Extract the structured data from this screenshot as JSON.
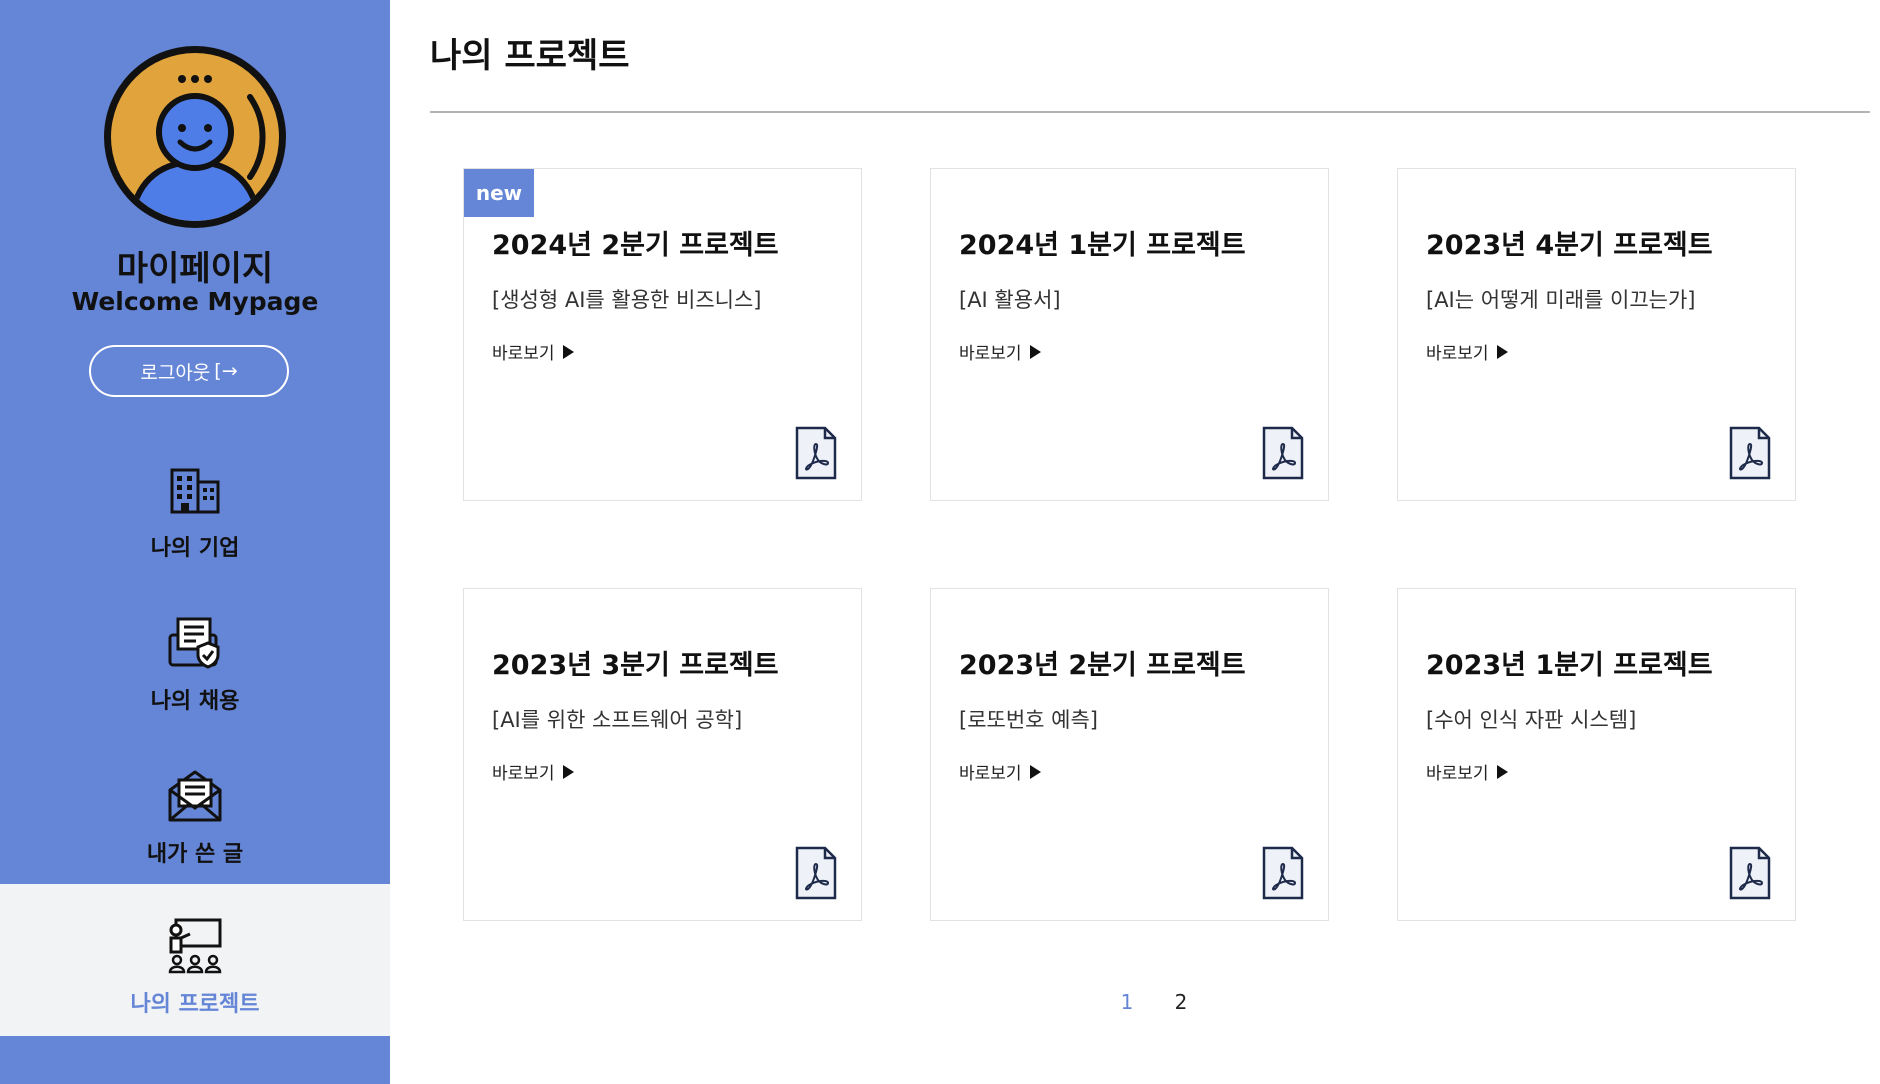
{
  "sidebar": {
    "title": "마이페이지",
    "subtitle": "Welcome Mypage",
    "logout_label": "로그아웃",
    "logout_arrow": "[→",
    "nav": [
      {
        "label": "나의 기업",
        "icon": "building-icon"
      },
      {
        "label": "나의 채용",
        "icon": "document-shield-icon"
      },
      {
        "label": "내가 쓴 글",
        "icon": "mail-icon"
      },
      {
        "label": "나의 프로젝트",
        "icon": "presentation-icon",
        "active": true
      }
    ],
    "colors": {
      "background": "#6585d6",
      "active_bg": "#f2f3f5",
      "avatar_ring": "#e1a43c",
      "avatar_person": "#4f7de8"
    }
  },
  "main": {
    "title": "나의 프로젝트",
    "cards": [
      {
        "badge": "new",
        "title": "2024년 2분기 프로젝트",
        "desc": "[생성형 AI를 활용한 비즈니스]",
        "link": "바로보기"
      },
      {
        "badge": "",
        "title": "2024년 1분기 프로젝트",
        "desc": "[AI 활용서]",
        "link": "바로보기"
      },
      {
        "badge": "",
        "title": "2023년 4분기 프로젝트",
        "desc": "[AI는 어떻게 미래를 이끄는가]",
        "link": "바로보기"
      },
      {
        "badge": "",
        "title": "2023년 3분기 프로젝트",
        "desc": "[AI를 위한 소프트웨어 공학]",
        "link": "바로보기"
      },
      {
        "badge": "",
        "title": "2023년 2분기 프로젝트",
        "desc": "[로또번호 예측]",
        "link": "바로보기"
      },
      {
        "badge": "",
        "title": "2023년 1분기 프로젝트",
        "desc": "[수어 인식 자판 시스템]",
        "link": "바로보기"
      }
    ],
    "pagination": {
      "pages": [
        "1",
        "2"
      ],
      "current": "1"
    }
  }
}
